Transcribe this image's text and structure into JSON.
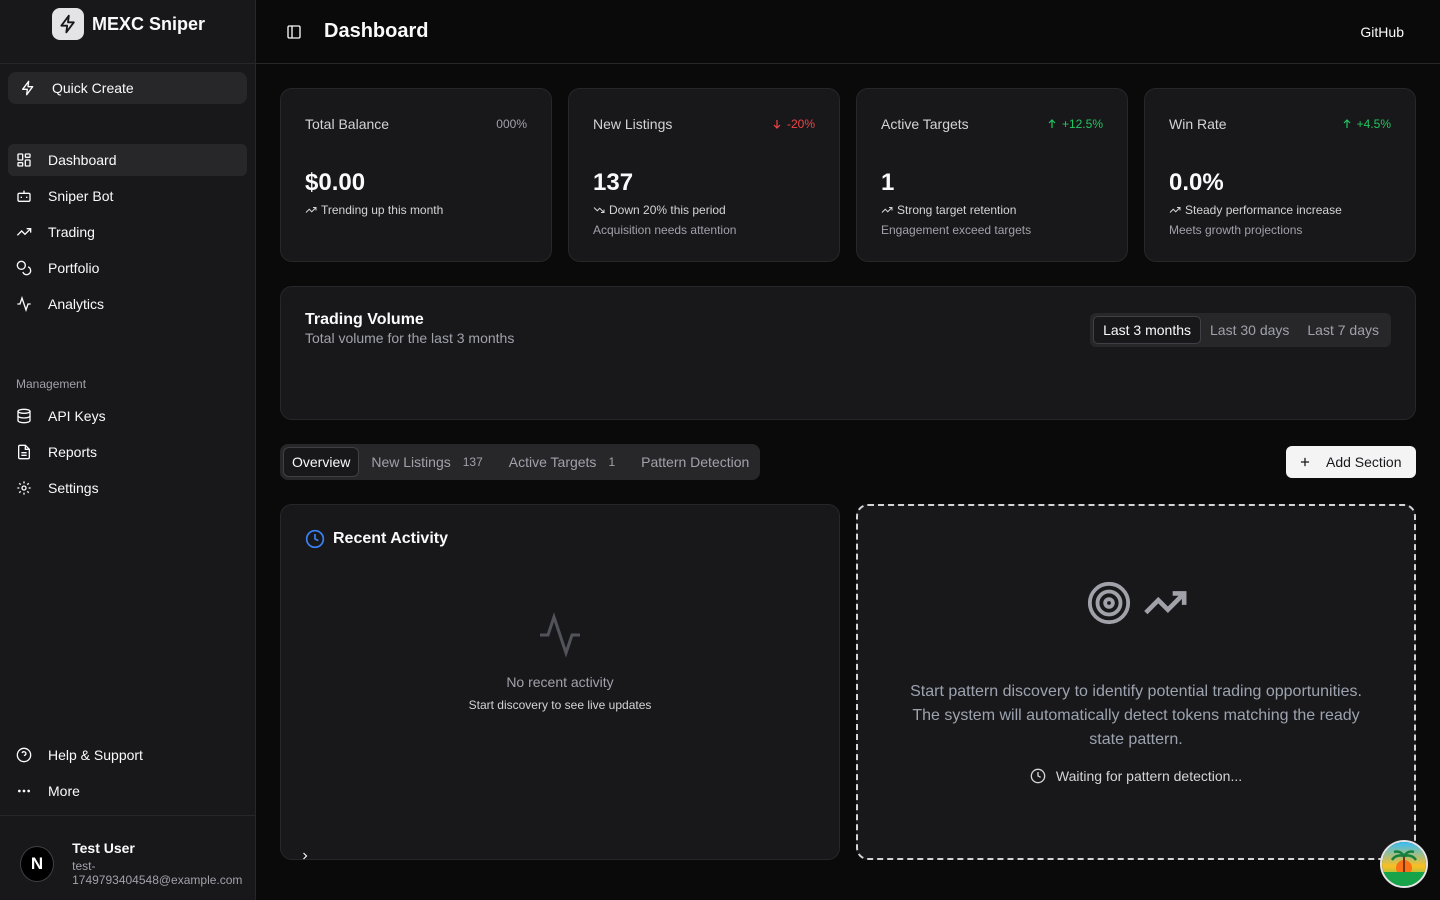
{
  "brand": {
    "name": "MEXC Sniper"
  },
  "sidebar": {
    "quick_create": "Quick Create",
    "main_items": [
      {
        "label": "Dashboard",
        "icon": "dashboard-icon"
      },
      {
        "label": "Sniper Bot",
        "icon": "bot-icon"
      },
      {
        "label": "Trading",
        "icon": "trending-up-icon"
      },
      {
        "label": "Portfolio",
        "icon": "coins-icon"
      },
      {
        "label": "Analytics",
        "icon": "activity-icon"
      }
    ],
    "management_label": "Management",
    "management_items": [
      {
        "label": "API Keys",
        "icon": "database-icon"
      },
      {
        "label": "Reports",
        "icon": "file-icon"
      },
      {
        "label": "Settings",
        "icon": "gear-icon"
      }
    ],
    "footer_items": [
      {
        "label": "Help & Support",
        "icon": "help-icon"
      },
      {
        "label": "More",
        "icon": "ellipsis-icon"
      }
    ],
    "user": {
      "initial": "N",
      "name": "Test User",
      "email": "test-1749793404548@example.com"
    }
  },
  "header": {
    "title": "Dashboard",
    "github": "GitHub"
  },
  "cards": [
    {
      "label": "Total Balance",
      "badge": "000%",
      "badge_color": "#a1a1aa",
      "value": "$0.00",
      "line1": "Trending up this month",
      "line2": ""
    },
    {
      "label": "New Listings",
      "badge": "-20%",
      "badge_color": "#ef4444",
      "value": "137",
      "line1": "Down 20% this period",
      "line2": "Acquisition needs attention"
    },
    {
      "label": "Active Targets",
      "badge": "+12.5%",
      "badge_color": "#22c55e",
      "value": "1",
      "line1": "Strong target retention",
      "line2": "Engagement exceed targets"
    },
    {
      "label": "Win Rate",
      "badge": "+4.5%",
      "badge_color": "#22c55e",
      "value": "0.0%",
      "line1": "Steady performance increase",
      "line2": "Meets growth projections"
    }
  ],
  "volume": {
    "title": "Trading Volume",
    "subtitle": "Total volume for the last 3 months",
    "ranges": [
      "Last 3 months",
      "Last 30 days",
      "Last 7 days"
    ],
    "selected_range": "Last 3 months"
  },
  "tabs": [
    {
      "label": "Overview",
      "count": ""
    },
    {
      "label": "New Listings",
      "count": "137"
    },
    {
      "label": "Active Targets",
      "count": "1"
    },
    {
      "label": "Pattern Detection",
      "count": ""
    }
  ],
  "add_section": "Add Section",
  "activity": {
    "title": "Recent Activity",
    "empty_title": "No recent activity",
    "empty_sub": "Start discovery to see live updates"
  },
  "pattern": {
    "text": "Start pattern discovery to identify potential trading opportunities. The system will automatically detect tokens matching the ready state pattern.",
    "waiting": "Waiting for pattern detection..."
  },
  "colors": {
    "accent_blue": "#3b82f6",
    "up": "#22c55e",
    "down": "#ef4444"
  }
}
